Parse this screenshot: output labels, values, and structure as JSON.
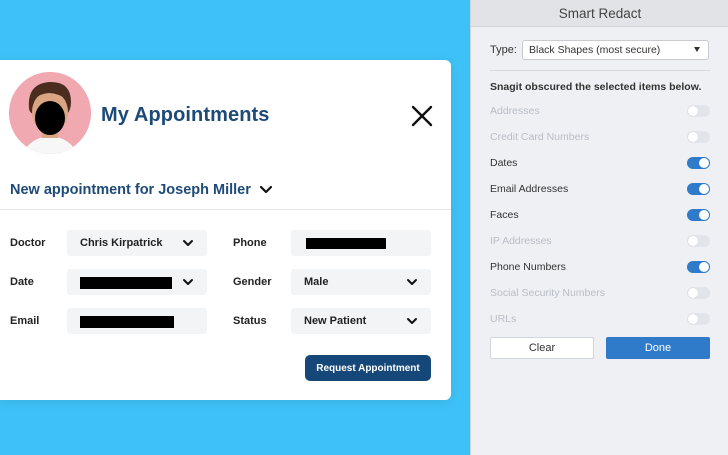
{
  "card": {
    "title": "My Appointments",
    "subtitle": "New appointment for Joseph Miller",
    "fields": {
      "doctor": {
        "label": "Doctor",
        "value": "Chris Kirpatrick"
      },
      "phone": {
        "label": "Phone",
        "value": ""
      },
      "date": {
        "label": "Date",
        "value": ""
      },
      "gender": {
        "label": "Gender",
        "value": "Male"
      },
      "email": {
        "label": "Email",
        "value": ""
      },
      "status": {
        "label": "Status",
        "value": "New Patient"
      }
    },
    "request_button": "Request Appointment"
  },
  "panel": {
    "title": "Smart Redact",
    "type_label": "Type:",
    "type_value": "Black Shapes (most secure)",
    "note": "Snagit obscured the selected items below.",
    "options": [
      {
        "label": "Addresses",
        "on": false,
        "enabled": false
      },
      {
        "label": "Credit Card Numbers",
        "on": false,
        "enabled": false
      },
      {
        "label": "Dates",
        "on": true,
        "enabled": true
      },
      {
        "label": "Email Addresses",
        "on": true,
        "enabled": true
      },
      {
        "label": "Faces",
        "on": true,
        "enabled": true
      },
      {
        "label": "IP Addresses",
        "on": false,
        "enabled": false
      },
      {
        "label": "Phone Numbers",
        "on": true,
        "enabled": true
      },
      {
        "label": "Social Security Numbers",
        "on": false,
        "enabled": false
      },
      {
        "label": "URLs",
        "on": false,
        "enabled": false
      }
    ],
    "clear_button": "Clear",
    "done_button": "Done"
  },
  "colors": {
    "background": "#3ec1f6",
    "accent": "#2f7ac9",
    "title": "#1d4a77",
    "request_button": "#154878",
    "disabled_text": "#b9bec5"
  },
  "icons": {
    "close": "close-icon",
    "chevron": "chevron-down-icon",
    "avatar": "avatar"
  }
}
